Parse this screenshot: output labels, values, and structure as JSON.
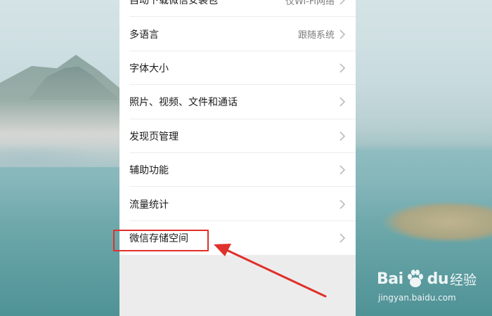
{
  "settings_menu": {
    "items": [
      {
        "label": "自动下载微信安装包",
        "value": "仅Wi-Fi网络"
      },
      {
        "label": "多语言",
        "value": "跟随系统"
      },
      {
        "label": "字体大小",
        "value": ""
      },
      {
        "label": "照片、视频、文件和通话",
        "value": ""
      },
      {
        "label": "发现页管理",
        "value": ""
      },
      {
        "label": "辅助功能",
        "value": ""
      },
      {
        "label": "流量统计",
        "value": ""
      },
      {
        "label": "微信存储空间",
        "value": ""
      }
    ]
  },
  "annotation": {
    "highlight_color": "#e0302b",
    "arrow_color": "#e0302b"
  },
  "watermark": {
    "logo_part1": "Bai",
    "logo_part2": "du",
    "logo_cn": "经验",
    "url": "jingyan.baidu.com"
  },
  "icons": {
    "chevron": "chevron-right-icon",
    "paw": "baidu-paw-icon"
  }
}
